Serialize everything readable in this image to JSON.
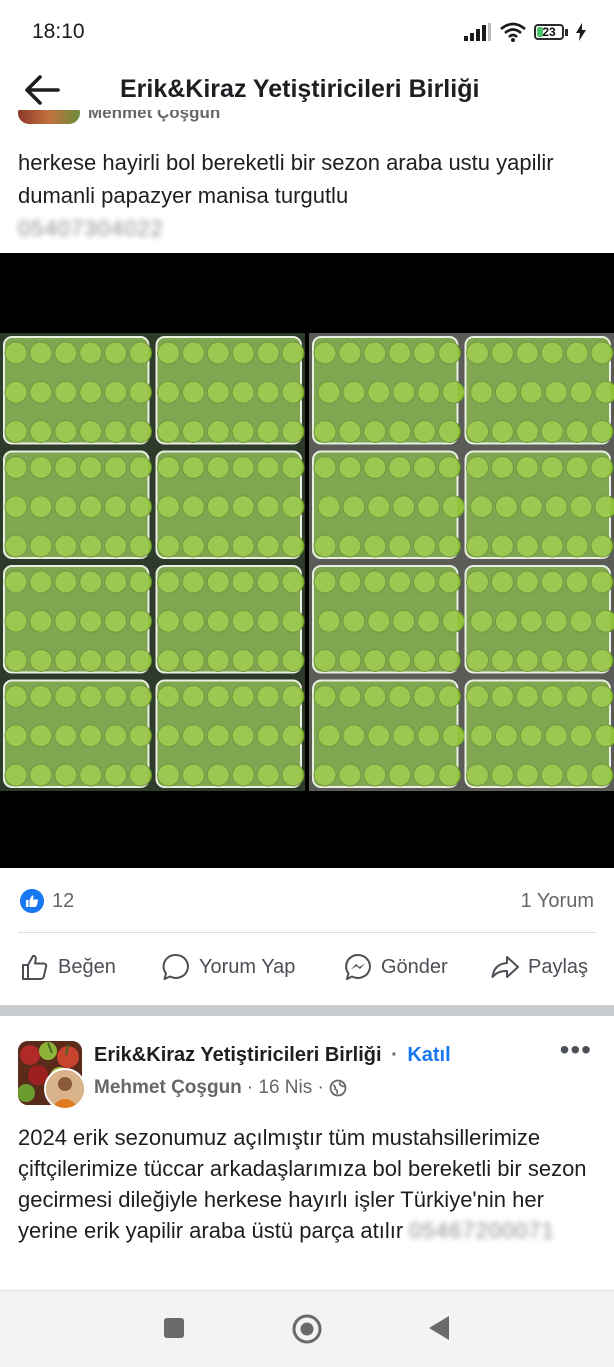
{
  "status_bar": {
    "time": "18:10",
    "battery": "23",
    "battery_level": 0.23,
    "icons": [
      "signal-icon",
      "wifi-icon",
      "battery-icon",
      "charging-icon"
    ]
  },
  "app_bar": {
    "back_icon": "back-arrow-icon",
    "title": "Erik&Kiraz Yetiştiricileri Birliği"
  },
  "post1": {
    "text": "herkese hayirli bol bereketli bir sezon araba ustu yapilir dumanli papazyer manisa turgutlu",
    "phone_blurred": "05407304022",
    "like_count": "12",
    "comment_count": "1 Yorum"
  },
  "actions": {
    "like": "Beğen",
    "comment": "Yorum Yap",
    "send": "Gönder",
    "share": "Paylaş"
  },
  "post2": {
    "group_name": "Erik&Kiraz Yetiştiricileri Birliği",
    "join": "Katıl",
    "dot": "·",
    "author": "Mehmet Çoşgun",
    "date": "· 16 Nis ·",
    "text": "2024 erik sezonumuz açılmıştır tüm mustahsillerimize çiftçilerimize tüccar arkadaşlarımıza bol bereketli bir sezon gecirmesi dileğiyle herkese hayırlı işler Türkiye'nin her yerine erik yapilir araba üstü parça atılır",
    "phone_blurred": "05467200071"
  },
  "colors": {
    "accent": "#1877f2",
    "text": "#1c1e21",
    "secondary": "#65676b",
    "separator": "#c9ccd1",
    "plum_green": "#8fc13a"
  }
}
